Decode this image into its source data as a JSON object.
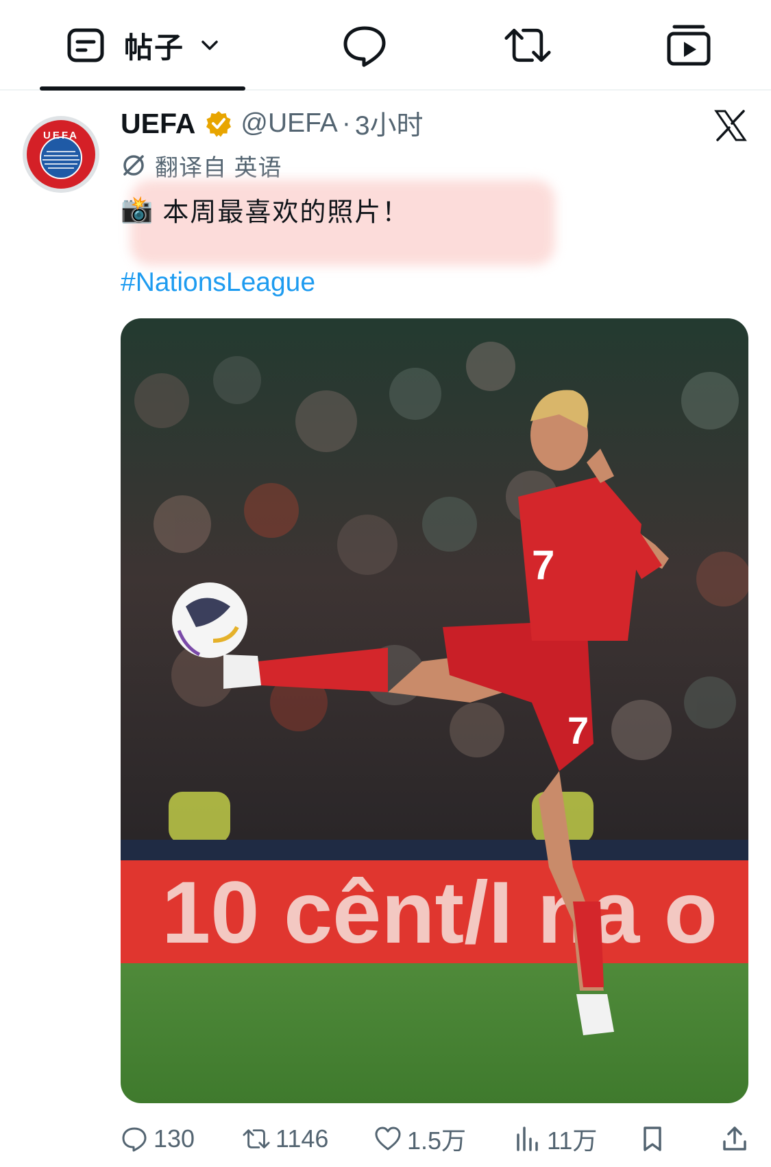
{
  "tabs": [
    {
      "label": "帖子",
      "icon": "post-icon",
      "active": true
    },
    {
      "icon": "reply-icon"
    },
    {
      "icon": "retweet-icon"
    },
    {
      "icon": "video-icon"
    }
  ],
  "tweet": {
    "display_name": "UEFA",
    "handle": "@UEFA",
    "separator": "·",
    "time": "3小时",
    "translated_from": "翻译自 英语",
    "emoji": "📸",
    "text": "本周最喜欢的照片！",
    "hashtag": "#NationsLeague",
    "avatar_text": "UEFA",
    "photo": {
      "board_text": "10 cênt/I na o",
      "shirt_number": "7"
    }
  },
  "actions": {
    "replies": "130",
    "retweets": "1146",
    "likes": "1.5万",
    "views": "11万"
  },
  "colors": {
    "accent": "#1d9bf0",
    "verified": "#e8a500",
    "secondary_text": "#536471"
  }
}
